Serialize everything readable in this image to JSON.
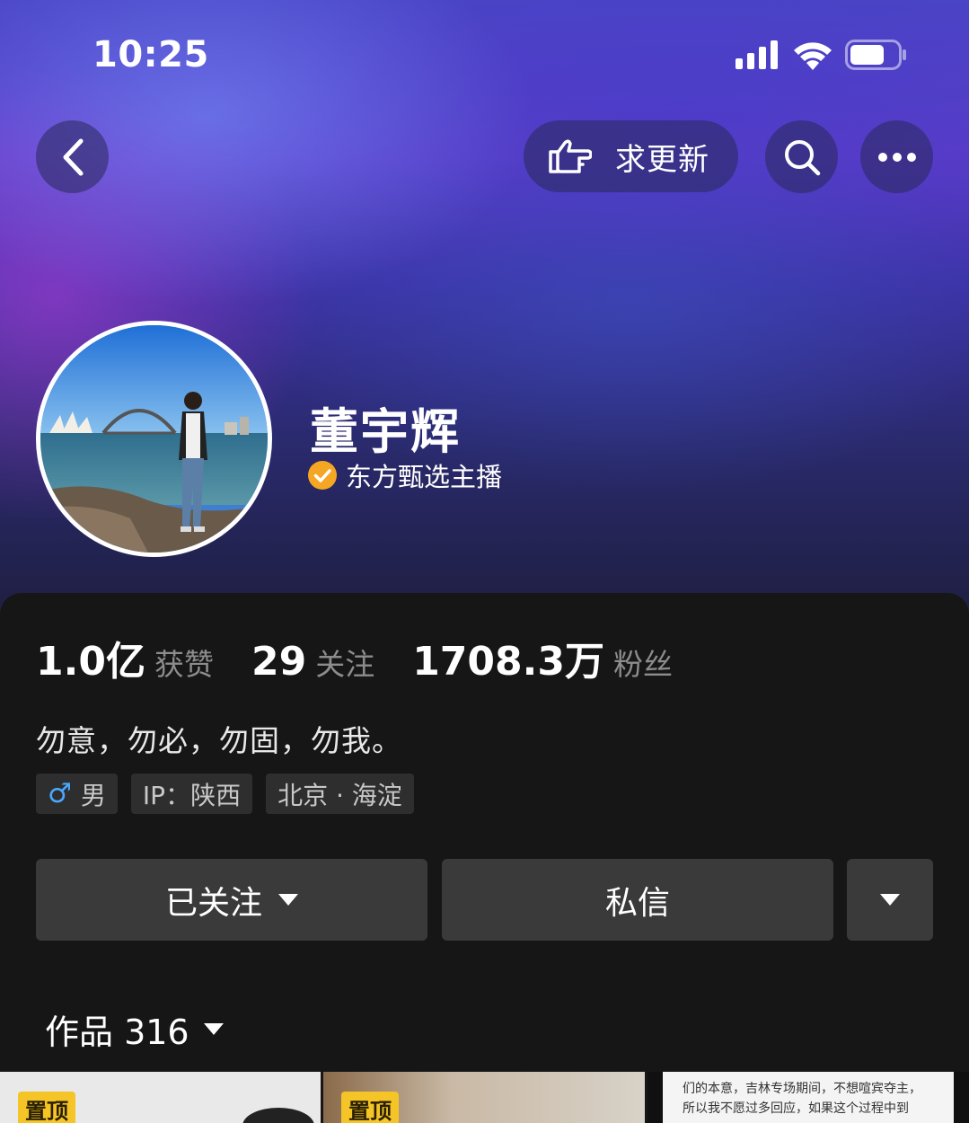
{
  "status_bar": {
    "time": "10:25",
    "icons": [
      "signal-icon",
      "wifi-icon",
      "battery-icon"
    ]
  },
  "header": {
    "back_icon": "chevron-left-icon",
    "update_button": {
      "icon": "pointing-hand-icon",
      "label": "求更新"
    },
    "search_icon": "search-icon",
    "more_icon": "more-horizontal-icon"
  },
  "profile": {
    "name": "董宇辉",
    "verified_label": "东方甄选主播",
    "verified_icon": "check-circle-icon",
    "stats": [
      {
        "value": "1.0亿",
        "label": "获赞"
      },
      {
        "value": "29",
        "label": "关注"
      },
      {
        "value": "1708.3万",
        "label": "粉丝"
      }
    ],
    "bio": "勿意，勿必，勿固，勿我。",
    "tags": [
      {
        "icon": "male-icon",
        "text": "男"
      },
      {
        "text": "IP：陕西"
      },
      {
        "text": "北京 · 海淀"
      }
    ]
  },
  "actions": {
    "follow_label": "已关注",
    "message_label": "私信",
    "more_dropdown_icon": "caret-down-icon"
  },
  "works": {
    "label": "作品 316"
  },
  "thumbnails": [
    {
      "pin_label": "置顶"
    },
    {
      "pin_label": "置顶"
    },
    {
      "text_lines": [
        "们的本意，吉林专场期间，不想喧宾夺主，",
        "所以我不愿过多回应，如果这个过程中到"
      ]
    }
  ],
  "colors": {
    "accent_verified": "#f5a623",
    "pin_badge": "#f5c426",
    "male_icon": "#4aa8ff",
    "panel_bg": "#161616",
    "button_bg": "#3a3a3a"
  }
}
